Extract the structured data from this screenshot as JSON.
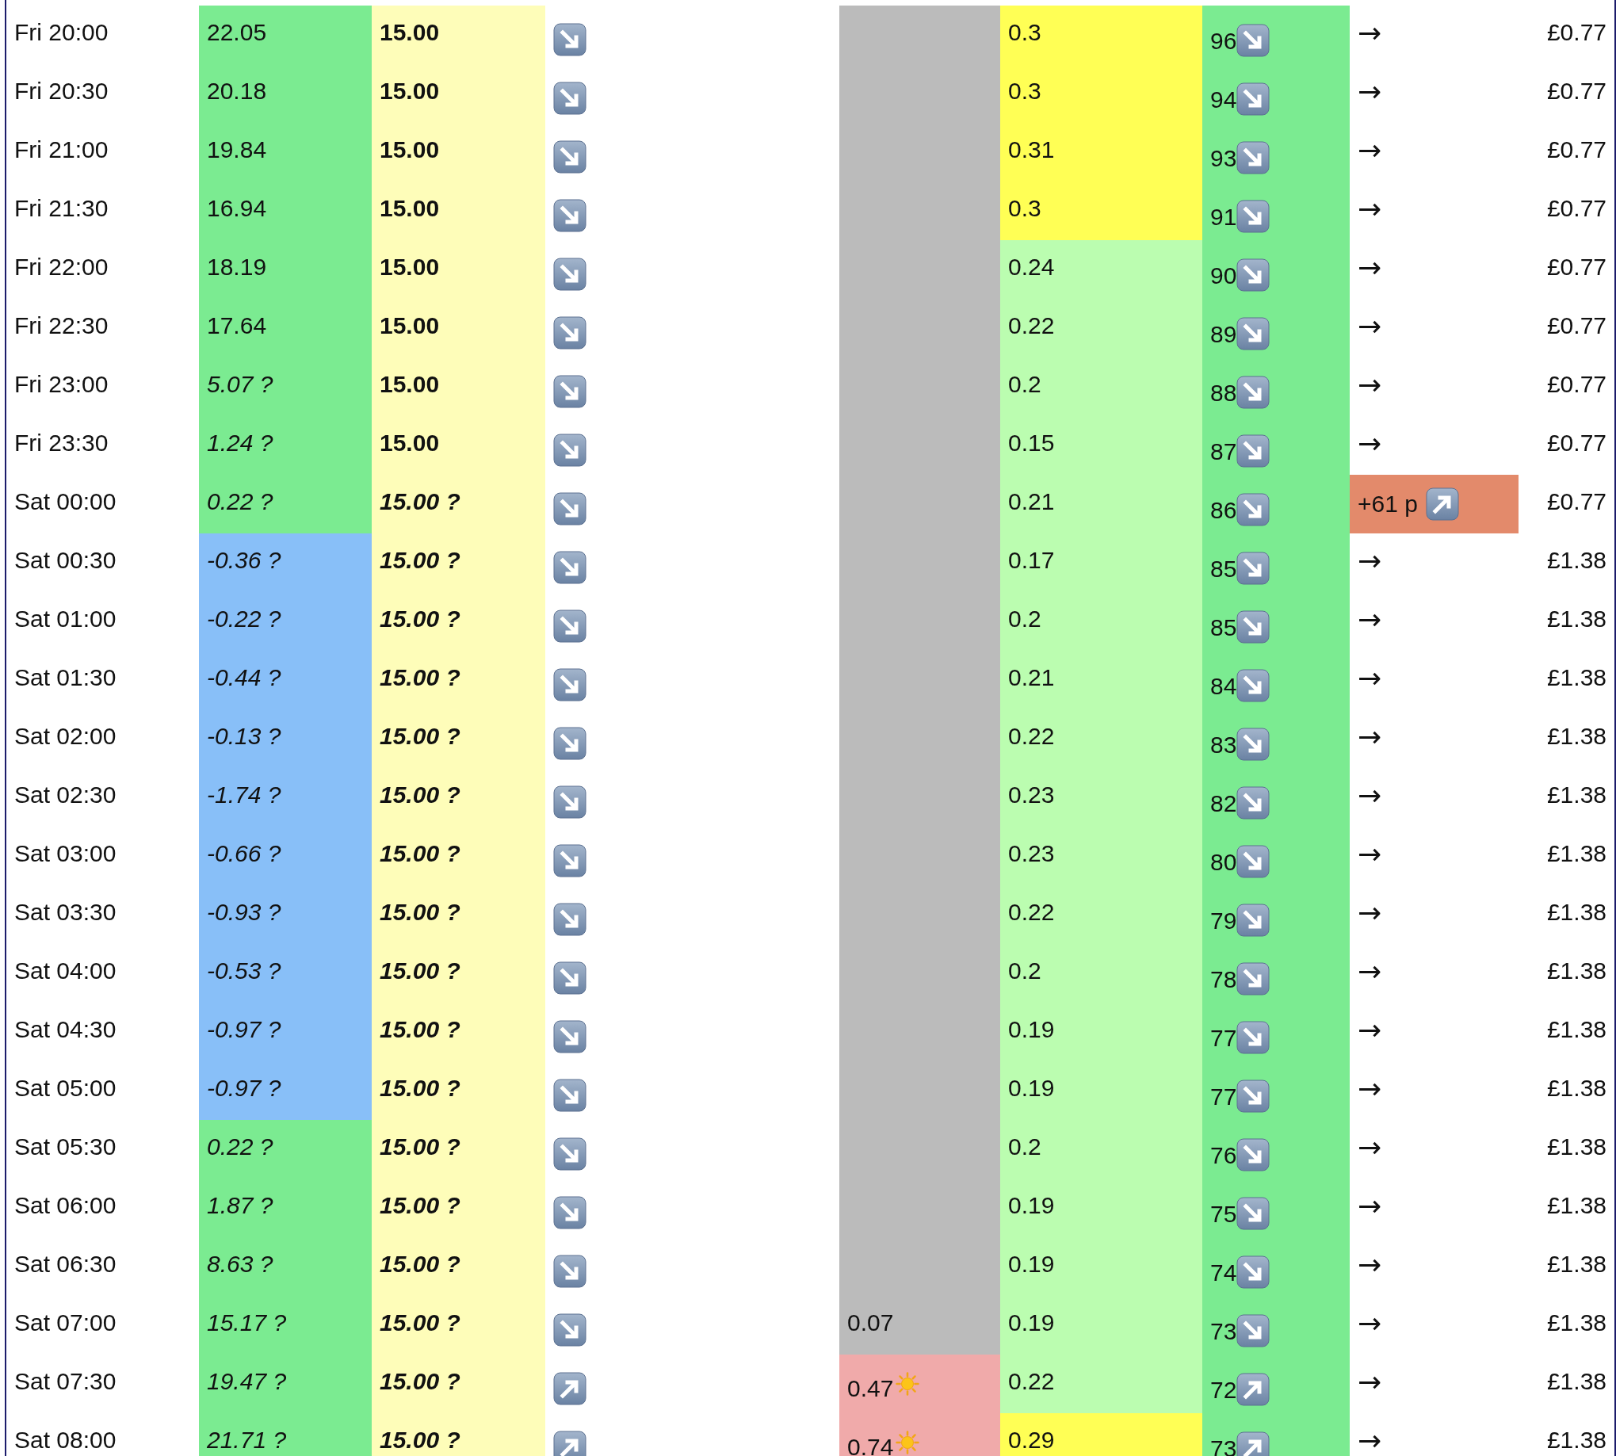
{
  "rows": [
    {
      "time": "Fri 20:00",
      "column_2": {
        "text": "22.05",
        "estimated": false,
        "color": "#7beb91"
      },
      "column_3": {
        "text": "15.00",
        "estimated": false
      },
      "column_4": {
        "rising": false
      },
      "column_5": {
        "color": "#bbbbbb"
      },
      "column_6": {
        "text": "0.3",
        "color": "#ffff55"
      },
      "column_7": {
        "text": "96",
        "rising": false
      },
      "column_8": {
        "kind": "arrow",
        "text": "→"
      },
      "price": "£0.77"
    },
    {
      "time": "Fri 20:30",
      "column_2": {
        "text": "20.18",
        "estimated": false,
        "color": "#7beb91"
      },
      "column_3": {
        "text": "15.00",
        "estimated": false
      },
      "column_4": {
        "rising": false
      },
      "column_5": {
        "color": "#bbbbbb"
      },
      "column_6": {
        "text": "0.3",
        "color": "#ffff55"
      },
      "column_7": {
        "text": "94",
        "rising": false
      },
      "column_8": {
        "kind": "arrow",
        "text": "→"
      },
      "price": "£0.77"
    },
    {
      "time": "Fri 21:00",
      "column_2": {
        "text": "19.84",
        "estimated": false,
        "color": "#7beb91"
      },
      "column_3": {
        "text": "15.00",
        "estimated": false
      },
      "column_4": {
        "rising": false
      },
      "column_5": {
        "color": "#bbbbbb"
      },
      "column_6": {
        "text": "0.31",
        "color": "#ffff55"
      },
      "column_7": {
        "text": "93",
        "rising": false
      },
      "column_8": {
        "kind": "arrow",
        "text": "→"
      },
      "price": "£0.77"
    },
    {
      "time": "Fri 21:30",
      "column_2": {
        "text": "16.94",
        "estimated": false,
        "color": "#7beb91"
      },
      "column_3": {
        "text": "15.00",
        "estimated": false
      },
      "column_4": {
        "rising": false
      },
      "column_5": {
        "color": "#bbbbbb"
      },
      "column_6": {
        "text": "0.3",
        "color": "#ffff55"
      },
      "column_7": {
        "text": "91",
        "rising": false
      },
      "column_8": {
        "kind": "arrow",
        "text": "→"
      },
      "price": "£0.77"
    },
    {
      "time": "Fri 22:00",
      "column_2": {
        "text": "18.19",
        "estimated": false,
        "color": "#7beb91"
      },
      "column_3": {
        "text": "15.00",
        "estimated": false
      },
      "column_4": {
        "rising": false
      },
      "column_5": {
        "color": "#bbbbbb"
      },
      "column_6": {
        "text": "0.24",
        "color": "#bbfdb0"
      },
      "column_7": {
        "text": "90",
        "rising": false
      },
      "column_8": {
        "kind": "arrow",
        "text": "→"
      },
      "price": "£0.77"
    },
    {
      "time": "Fri 22:30",
      "column_2": {
        "text": "17.64",
        "estimated": false,
        "color": "#7beb91"
      },
      "column_3": {
        "text": "15.00",
        "estimated": false
      },
      "column_4": {
        "rising": false
      },
      "column_5": {
        "color": "#bbbbbb"
      },
      "column_6": {
        "text": "0.22",
        "color": "#bbfdb0"
      },
      "column_7": {
        "text": "89",
        "rising": false
      },
      "column_8": {
        "kind": "arrow",
        "text": "→"
      },
      "price": "£0.77"
    },
    {
      "time": "Fri 23:00",
      "column_2": {
        "text": "5.07 ?",
        "estimated": true,
        "color": "#7beb91"
      },
      "column_3": {
        "text": "15.00",
        "estimated": false
      },
      "column_4": {
        "rising": false
      },
      "column_5": {
        "color": "#bbbbbb"
      },
      "column_6": {
        "text": "0.2",
        "color": "#bbfdb0"
      },
      "column_7": {
        "text": "88",
        "rising": false
      },
      "column_8": {
        "kind": "arrow",
        "text": "→"
      },
      "price": "£0.77"
    },
    {
      "time": "Fri 23:30",
      "column_2": {
        "text": "1.24 ?",
        "estimated": true,
        "color": "#7beb91"
      },
      "column_3": {
        "text": "15.00",
        "estimated": false
      },
      "column_4": {
        "rising": false
      },
      "column_5": {
        "color": "#bbbbbb"
      },
      "column_6": {
        "text": "0.15",
        "color": "#bbfdb0"
      },
      "column_7": {
        "text": "87",
        "rising": false
      },
      "column_8": {
        "kind": "arrow",
        "text": "→"
      },
      "price": "£0.77"
    },
    {
      "time": "Sat 00:00",
      "column_2": {
        "text": "0.22 ?",
        "estimated": true,
        "color": "#7beb91"
      },
      "column_3": {
        "text": "15.00 ?",
        "estimated": true
      },
      "column_4": {
        "rising": false
      },
      "column_5": {
        "color": "#bbbbbb"
      },
      "column_6": {
        "text": "0.21",
        "color": "#bbfdb0"
      },
      "column_7": {
        "text": "86",
        "rising": false
      },
      "column_8": {
        "kind": "change",
        "text": "+61 p",
        "rising": true,
        "color": "#e38a6b"
      },
      "price": "£0.77"
    },
    {
      "time": "Sat 00:30",
      "column_2": {
        "text": "-0.36 ?",
        "estimated": true,
        "color": "#88bff8"
      },
      "column_3": {
        "text": "15.00 ?",
        "estimated": true
      },
      "column_4": {
        "rising": false
      },
      "column_5": {
        "color": "#bbbbbb"
      },
      "column_6": {
        "text": "0.17",
        "color": "#bbfdb0"
      },
      "column_7": {
        "text": "85",
        "rising": false
      },
      "column_8": {
        "kind": "arrow",
        "text": "→"
      },
      "price": "£1.38"
    },
    {
      "time": "Sat 01:00",
      "column_2": {
        "text": "-0.22 ?",
        "estimated": true,
        "color": "#88bff8"
      },
      "column_3": {
        "text": "15.00 ?",
        "estimated": true
      },
      "column_4": {
        "rising": false
      },
      "column_5": {
        "color": "#bbbbbb"
      },
      "column_6": {
        "text": "0.2",
        "color": "#bbfdb0"
      },
      "column_7": {
        "text": "85",
        "rising": false
      },
      "column_8": {
        "kind": "arrow",
        "text": "→"
      },
      "price": "£1.38"
    },
    {
      "time": "Sat 01:30",
      "column_2": {
        "text": "-0.44 ?",
        "estimated": true,
        "color": "#88bff8"
      },
      "column_3": {
        "text": "15.00 ?",
        "estimated": true
      },
      "column_4": {
        "rising": false
      },
      "column_5": {
        "color": "#bbbbbb"
      },
      "column_6": {
        "text": "0.21",
        "color": "#bbfdb0"
      },
      "column_7": {
        "text": "84",
        "rising": false
      },
      "column_8": {
        "kind": "arrow",
        "text": "→"
      },
      "price": "£1.38"
    },
    {
      "time": "Sat 02:00",
      "column_2": {
        "text": "-0.13 ?",
        "estimated": true,
        "color": "#88bff8"
      },
      "column_3": {
        "text": "15.00 ?",
        "estimated": true
      },
      "column_4": {
        "rising": false
      },
      "column_5": {
        "color": "#bbbbbb"
      },
      "column_6": {
        "text": "0.22",
        "color": "#bbfdb0"
      },
      "column_7": {
        "text": "83",
        "rising": false
      },
      "column_8": {
        "kind": "arrow",
        "text": "→"
      },
      "price": "£1.38"
    },
    {
      "time": "Sat 02:30",
      "column_2": {
        "text": "-1.74 ?",
        "estimated": true,
        "color": "#88bff8"
      },
      "column_3": {
        "text": "15.00 ?",
        "estimated": true
      },
      "column_4": {
        "rising": false
      },
      "column_5": {
        "color": "#bbbbbb"
      },
      "column_6": {
        "text": "0.23",
        "color": "#bbfdb0"
      },
      "column_7": {
        "text": "82",
        "rising": false
      },
      "column_8": {
        "kind": "arrow",
        "text": "→"
      },
      "price": "£1.38"
    },
    {
      "time": "Sat 03:00",
      "column_2": {
        "text": "-0.66 ?",
        "estimated": true,
        "color": "#88bff8"
      },
      "column_3": {
        "text": "15.00 ?",
        "estimated": true
      },
      "column_4": {
        "rising": false
      },
      "column_5": {
        "color": "#bbbbbb"
      },
      "column_6": {
        "text": "0.23",
        "color": "#bbfdb0"
      },
      "column_7": {
        "text": "80",
        "rising": false
      },
      "column_8": {
        "kind": "arrow",
        "text": "→"
      },
      "price": "£1.38"
    },
    {
      "time": "Sat 03:30",
      "column_2": {
        "text": "-0.93 ?",
        "estimated": true,
        "color": "#88bff8"
      },
      "column_3": {
        "text": "15.00 ?",
        "estimated": true
      },
      "column_4": {
        "rising": false
      },
      "column_5": {
        "color": "#bbbbbb"
      },
      "column_6": {
        "text": "0.22",
        "color": "#bbfdb0"
      },
      "column_7": {
        "text": "79",
        "rising": false
      },
      "column_8": {
        "kind": "arrow",
        "text": "→"
      },
      "price": "£1.38"
    },
    {
      "time": "Sat 04:00",
      "column_2": {
        "text": "-0.53 ?",
        "estimated": true,
        "color": "#88bff8"
      },
      "column_3": {
        "text": "15.00 ?",
        "estimated": true
      },
      "column_4": {
        "rising": false
      },
      "column_5": {
        "color": "#bbbbbb"
      },
      "column_6": {
        "text": "0.2",
        "color": "#bbfdb0"
      },
      "column_7": {
        "text": "78",
        "rising": false
      },
      "column_8": {
        "kind": "arrow",
        "text": "→"
      },
      "price": "£1.38"
    },
    {
      "time": "Sat 04:30",
      "column_2": {
        "text": "-0.97 ?",
        "estimated": true,
        "color": "#88bff8"
      },
      "column_3": {
        "text": "15.00 ?",
        "estimated": true
      },
      "column_4": {
        "rising": false
      },
      "column_5": {
        "color": "#bbbbbb"
      },
      "column_6": {
        "text": "0.19",
        "color": "#bbfdb0"
      },
      "column_7": {
        "text": "77",
        "rising": false
      },
      "column_8": {
        "kind": "arrow",
        "text": "→"
      },
      "price": "£1.38"
    },
    {
      "time": "Sat 05:00",
      "column_2": {
        "text": "-0.97 ?",
        "estimated": true,
        "color": "#88bff8"
      },
      "column_3": {
        "text": "15.00 ?",
        "estimated": true
      },
      "column_4": {
        "rising": false
      },
      "column_5": {
        "color": "#bbbbbb"
      },
      "column_6": {
        "text": "0.19",
        "color": "#bbfdb0"
      },
      "column_7": {
        "text": "77",
        "rising": false
      },
      "column_8": {
        "kind": "arrow",
        "text": "→"
      },
      "price": "£1.38"
    },
    {
      "time": "Sat 05:30",
      "column_2": {
        "text": "0.22 ?",
        "estimated": true,
        "color": "#7beb91"
      },
      "column_3": {
        "text": "15.00 ?",
        "estimated": true
      },
      "column_4": {
        "rising": false
      },
      "column_5": {
        "color": "#bbbbbb"
      },
      "column_6": {
        "text": "0.2",
        "color": "#bbfdb0"
      },
      "column_7": {
        "text": "76",
        "rising": false
      },
      "column_8": {
        "kind": "arrow",
        "text": "→"
      },
      "price": "£1.38"
    },
    {
      "time": "Sat 06:00",
      "column_2": {
        "text": "1.87 ?",
        "estimated": true,
        "color": "#7beb91"
      },
      "column_3": {
        "text": "15.00 ?",
        "estimated": true
      },
      "column_4": {
        "rising": false
      },
      "column_5": {
        "color": "#bbbbbb"
      },
      "column_6": {
        "text": "0.19",
        "color": "#bbfdb0"
      },
      "column_7": {
        "text": "75",
        "rising": false
      },
      "column_8": {
        "kind": "arrow",
        "text": "→"
      },
      "price": "£1.38"
    },
    {
      "time": "Sat 06:30",
      "column_2": {
        "text": "8.63 ?",
        "estimated": true,
        "color": "#7beb91"
      },
      "column_3": {
        "text": "15.00 ?",
        "estimated": true
      },
      "column_4": {
        "rising": false
      },
      "column_5": {
        "color": "#bbbbbb"
      },
      "column_6": {
        "text": "0.19",
        "color": "#bbfdb0"
      },
      "column_7": {
        "text": "74",
        "rising": false
      },
      "column_8": {
        "kind": "arrow",
        "text": "→"
      },
      "price": "£1.38"
    },
    {
      "time": "Sat 07:00",
      "column_2": {
        "text": "15.17 ?",
        "estimated": true,
        "color": "#7beb91"
      },
      "column_3": {
        "text": "15.00 ?",
        "estimated": true
      },
      "column_4": {
        "rising": false
      },
      "column_5": {
        "text": "0.07",
        "sun": false,
        "color": "#bbbbbb"
      },
      "column_6": {
        "text": "0.19",
        "color": "#bbfdb0"
      },
      "column_7": {
        "text": "73",
        "rising": false
      },
      "column_8": {
        "kind": "arrow",
        "text": "→"
      },
      "price": "£1.38"
    },
    {
      "time": "Sat 07:30",
      "column_2": {
        "text": "19.47 ?",
        "estimated": true,
        "color": "#7beb91"
      },
      "column_3": {
        "text": "15.00 ?",
        "estimated": true
      },
      "column_4": {
        "rising": true
      },
      "column_5": {
        "text": "0.47",
        "sun": true,
        "color": "#f0aaaa"
      },
      "column_6": {
        "text": "0.22",
        "color": "#bbfdb0"
      },
      "column_7": {
        "text": "72",
        "rising": true
      },
      "column_8": {
        "kind": "arrow",
        "text": "→"
      },
      "price": "£1.38"
    },
    {
      "time": "Sat 08:00",
      "column_2": {
        "text": "21.71 ?",
        "estimated": true,
        "color": "#7beb91"
      },
      "column_3": {
        "text": "15.00 ?",
        "estimated": true
      },
      "column_4": {
        "rising": true
      },
      "column_5": {
        "text": "0.74",
        "sun": true,
        "color": "#f0aaaa"
      },
      "column_6": {
        "text": "0.29",
        "color": "#ffff55"
      },
      "column_7": {
        "text": "73",
        "rising": true
      },
      "column_8": {
        "kind": "arrow",
        "text": "→"
      },
      "price": "£1.38"
    }
  ]
}
